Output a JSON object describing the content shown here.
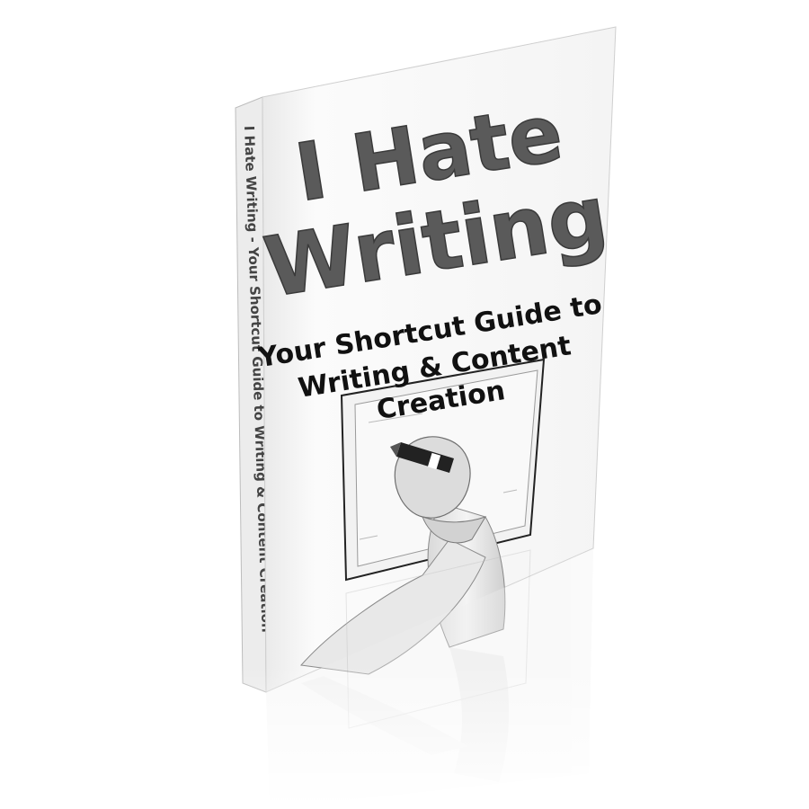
{
  "book": {
    "title_line1": "I Hate",
    "title_line2": "Writing",
    "subtitle_line1": "Your Shortcut Guide to",
    "subtitle_line2": "Writing & Content",
    "subtitle_line3": "Creation",
    "spine_text": "I Hate Writing - Your Shortcut Guide to Writing & Content Creation"
  },
  "colors": {
    "background": "#ffffff",
    "title_gray": "#5a5a5a",
    "subtitle_black": "#111111",
    "spine_gray": "#444444",
    "cover_white": "#f7f7f7"
  },
  "icons": [
    "hand-writing-illustration",
    "notepad-illustration",
    "pen-icon"
  ]
}
